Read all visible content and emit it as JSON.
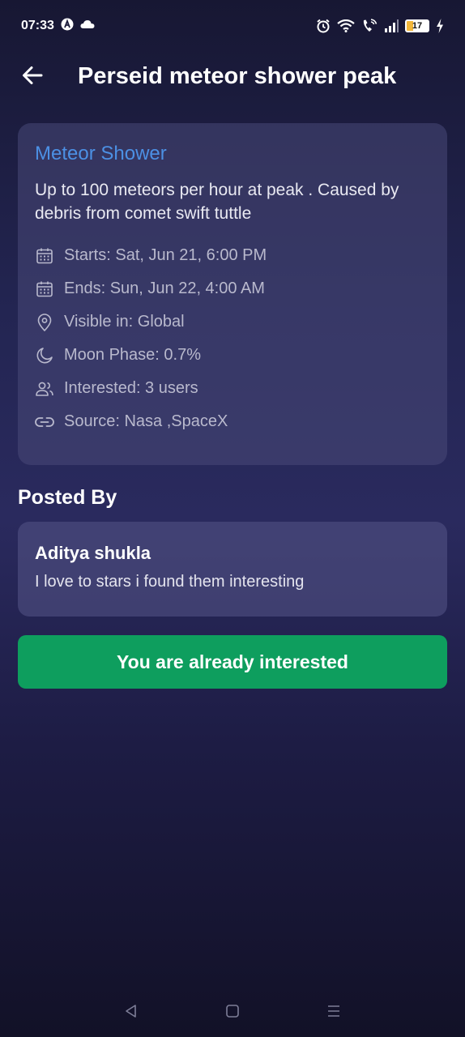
{
  "status_bar": {
    "time": "07:33",
    "battery_level": "17",
    "icons": [
      "a-icon",
      "cloud-icon",
      "alarm-icon",
      "wifi-icon",
      "wifi-call-icon",
      "signal-icon",
      "battery-icon",
      "charging-icon"
    ]
  },
  "header": {
    "title": "Perseid meteor shower peak",
    "back_icon": "arrow-left-icon"
  },
  "event": {
    "type": "Meteor Shower",
    "description": "Up to 100 meteors per hour at peak . Caused by debris from comet swift tuttle",
    "details": [
      {
        "icon": "calendar-icon",
        "text": "Starts: Sat, Jun 21, 6:00 PM"
      },
      {
        "icon": "calendar-icon",
        "text": "Ends: Sun, Jun 22, 4:00 AM"
      },
      {
        "icon": "location-pin-icon",
        "text": "Visible in: Global"
      },
      {
        "icon": "moon-icon",
        "text": "Moon Phase: 0.7%"
      },
      {
        "icon": "users-icon",
        "text": "Interested: 3 users"
      },
      {
        "icon": "link-icon",
        "text": "Source: Nasa ,SpaceX"
      }
    ],
    "type_color": "#4c90e4"
  },
  "posted_by": {
    "section_title": "Posted By",
    "name": "Aditya shukla",
    "bio": "I love to stars i found them interesting"
  },
  "action": {
    "label": "You are already interested",
    "color": "#0e9e5e"
  },
  "nav_bar": {
    "icons": [
      "back-triangle-icon",
      "home-square-icon",
      "menu-lines-icon"
    ]
  }
}
